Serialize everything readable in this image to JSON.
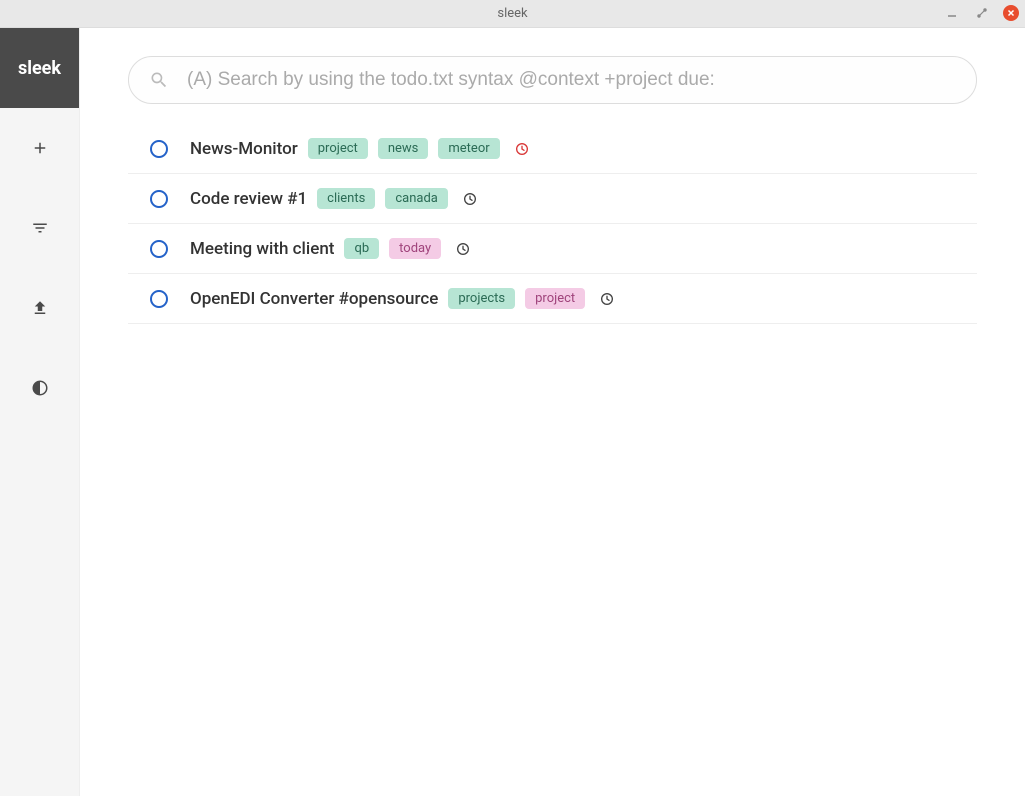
{
  "window": {
    "title": "sleek"
  },
  "sidebar": {
    "logo": "sleek"
  },
  "search": {
    "placeholder": "(A) Search by using the todo.txt syntax @context +project due:"
  },
  "todos": [
    {
      "title": "News-Monitor",
      "tags": [
        {
          "label": "project",
          "type": "context"
        },
        {
          "label": "news",
          "type": "context"
        },
        {
          "label": "meteor",
          "type": "context"
        }
      ],
      "due": "overdue"
    },
    {
      "title": "Code review #1",
      "tags": [
        {
          "label": "clients",
          "type": "context"
        },
        {
          "label": "canada",
          "type": "context"
        }
      ],
      "due": "normal"
    },
    {
      "title": "Meeting with client",
      "tags": [
        {
          "label": "qb",
          "type": "context"
        },
        {
          "label": "today",
          "type": "project"
        }
      ],
      "due": "normal"
    },
    {
      "title": "OpenEDI Converter #opensource",
      "tags": [
        {
          "label": "projects",
          "type": "context"
        },
        {
          "label": "project",
          "type": "project"
        }
      ],
      "due": "normal"
    }
  ]
}
